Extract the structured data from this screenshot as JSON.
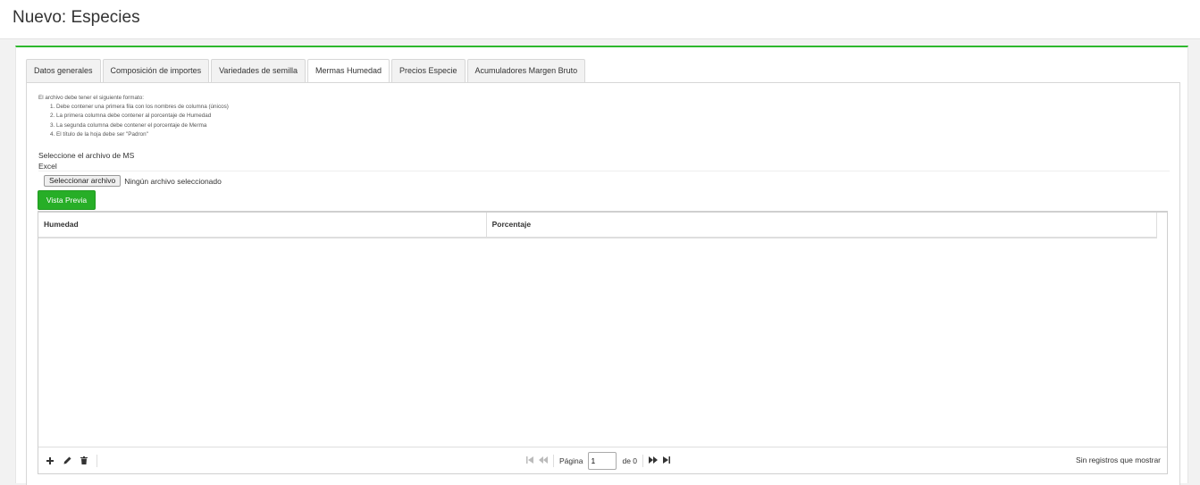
{
  "page": {
    "title": "Nuevo: Especies"
  },
  "tabs": [
    {
      "label": "Datos generales",
      "active": false
    },
    {
      "label": "Composición de importes",
      "active": false
    },
    {
      "label": "Variedades de semilla",
      "active": false
    },
    {
      "label": "Mermas Humedad",
      "active": true
    },
    {
      "label": "Precios Especie",
      "active": false
    },
    {
      "label": "Acumuladores Margen Bruto",
      "active": false
    }
  ],
  "instructions": {
    "intro": "El archivo debe tener el siguiente formato:",
    "items": [
      "Debe contener una primera fila con los nombres de columna (únicos)",
      "La primera columna debe contener al porcentaje de Humedad",
      "La segunda columna debe contener el porcentaje de Merma",
      "El título de la hoja debe ser \"Padron\""
    ]
  },
  "upload": {
    "label": "Seleccione el archivo de MS Excel",
    "button": "Seleccionar archivo",
    "status": "Ningún archivo seleccionado",
    "preview_button": "Vista Previa"
  },
  "grid": {
    "columns": [
      "Humedad",
      "Porcentaje"
    ],
    "rows": []
  },
  "pager": {
    "page_label": "Página",
    "page_value": "1",
    "of_label": "de 0",
    "records_text": "Sin registros que mostrar"
  },
  "colors": {
    "accent_green": "#2eb82e",
    "button_green": "#27ae27"
  }
}
